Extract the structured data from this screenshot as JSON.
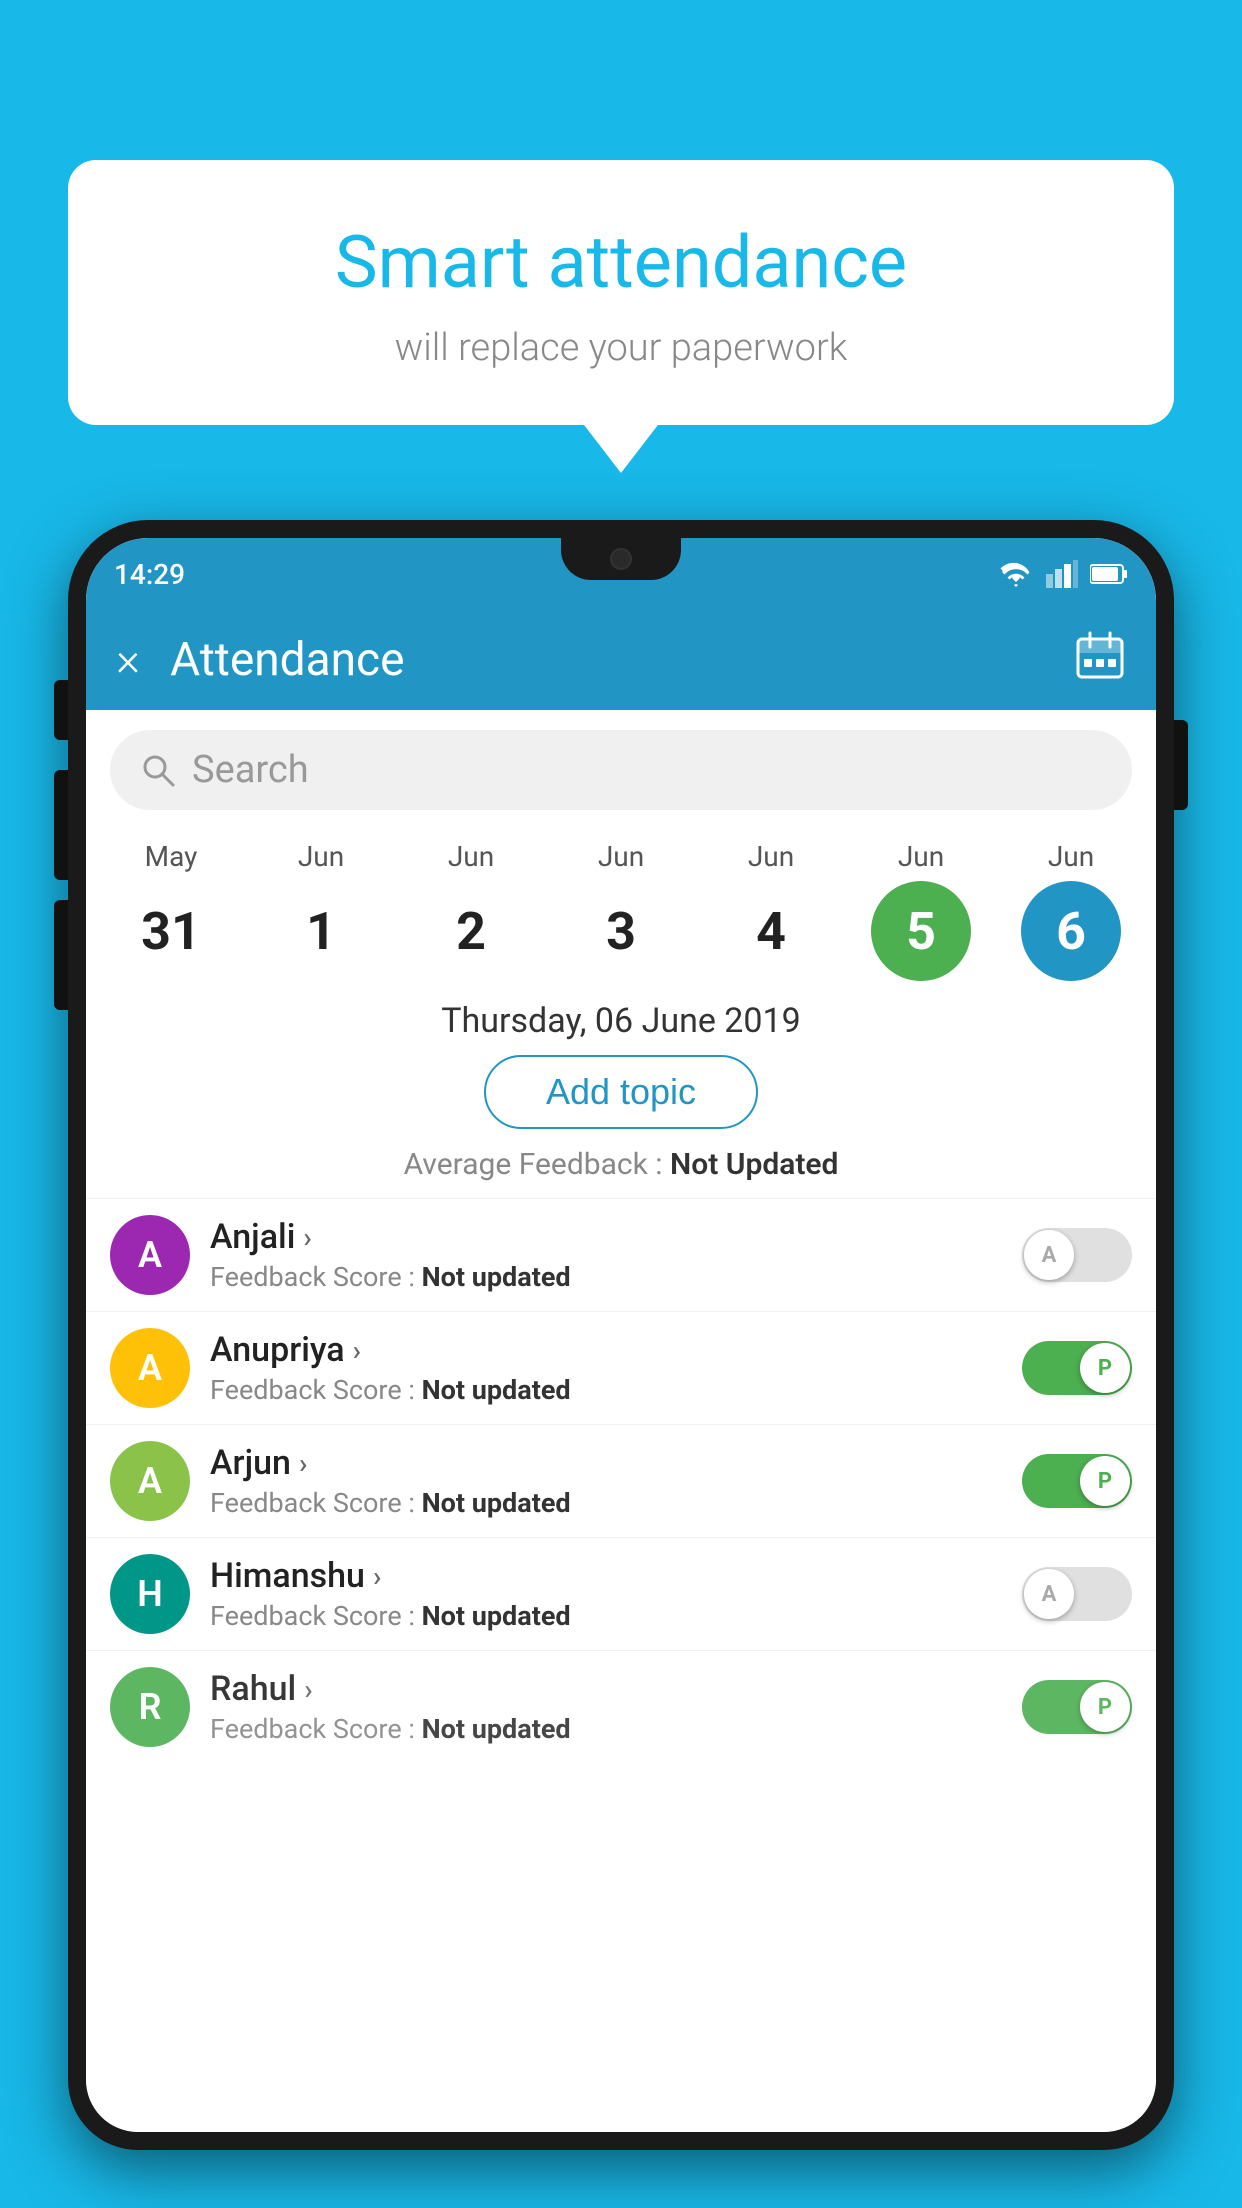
{
  "background_color": "#18b8e8",
  "bubble": {
    "title": "Smart attendance",
    "subtitle": "will replace your paperwork"
  },
  "phone": {
    "status_bar": {
      "time": "14:29"
    },
    "app_bar": {
      "title": "Attendance",
      "close_label": "×",
      "calendar_icon": "calendar"
    },
    "search": {
      "placeholder": "Search"
    },
    "calendar": {
      "days": [
        {
          "month": "May",
          "day": "31",
          "state": "normal"
        },
        {
          "month": "Jun",
          "day": "1",
          "state": "normal"
        },
        {
          "month": "Jun",
          "day": "2",
          "state": "normal"
        },
        {
          "month": "Jun",
          "day": "3",
          "state": "normal"
        },
        {
          "month": "Jun",
          "day": "4",
          "state": "normal"
        },
        {
          "month": "Jun",
          "day": "5",
          "state": "today"
        },
        {
          "month": "Jun",
          "day": "6",
          "state": "selected"
        }
      ]
    },
    "selected_date": "Thursday, 06 June 2019",
    "add_topic_label": "Add topic",
    "average_feedback_label": "Average Feedback :",
    "average_feedback_value": "Not Updated",
    "students": [
      {
        "name": "Anjali",
        "initial": "A",
        "avatar_color": "purple",
        "feedback_label": "Feedback Score :",
        "feedback_value": "Not updated",
        "toggle_state": "off",
        "toggle_letter": "A"
      },
      {
        "name": "Anupriya",
        "initial": "A",
        "avatar_color": "yellow",
        "feedback_label": "Feedback Score :",
        "feedback_value": "Not updated",
        "toggle_state": "on",
        "toggle_letter": "P"
      },
      {
        "name": "Arjun",
        "initial": "A",
        "avatar_color": "light-green",
        "feedback_label": "Feedback Score :",
        "feedback_value": "Not updated",
        "toggle_state": "on",
        "toggle_letter": "P"
      },
      {
        "name": "Himanshu",
        "initial": "H",
        "avatar_color": "teal",
        "feedback_label": "Feedback Score :",
        "feedback_value": "Not updated",
        "toggle_state": "off",
        "toggle_letter": "A"
      },
      {
        "name": "Rahul",
        "initial": "R",
        "avatar_color": "green",
        "feedback_label": "Feedback Score :",
        "feedback_value": "Not updated",
        "toggle_state": "on",
        "toggle_letter": "P"
      }
    ]
  }
}
